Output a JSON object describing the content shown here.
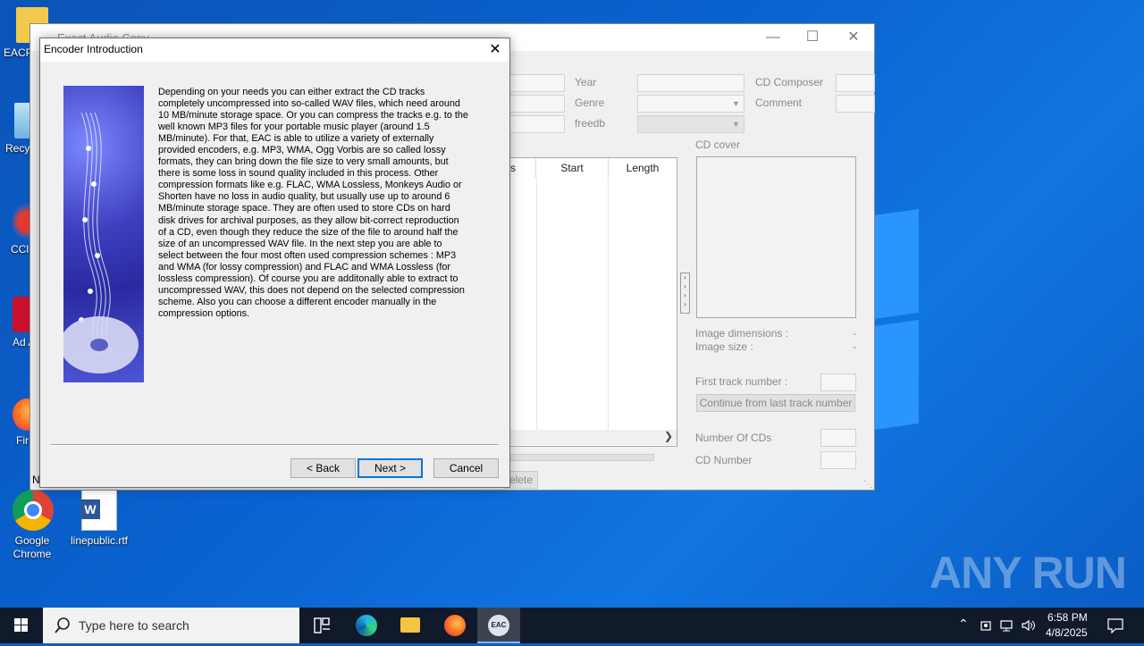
{
  "desktop": {
    "icons": [
      {
        "label": "EACP",
        "name": "desktop-icon-eac-folder"
      },
      {
        "label": "Recyc",
        "name": "desktop-icon-recycle-bin"
      },
      {
        "label": "CCl",
        "name": "desktop-icon-ccleaner"
      },
      {
        "label": "Ad Acr",
        "name": "desktop-icon-acrobat"
      },
      {
        "label": "Fir",
        "name": "desktop-icon-firefox"
      },
      {
        "label": "Google Chrome",
        "name": "desktop-icon-chrome"
      },
      {
        "label": "linepublic.rtf",
        "name": "desktop-icon-rtf-file"
      }
    ],
    "watermark": "ANY RUN"
  },
  "eac_window": {
    "title": "Exact Audio Copy",
    "labels": {
      "year": "Year",
      "genre": "Genre",
      "freedb": "freedb",
      "cd_composer": "CD Composer",
      "comment": "Comment",
      "cd_cover": "CD cover",
      "image_dimensions": "Image dimensions :",
      "image_dimensions_value": "-",
      "image_size": "Image size :",
      "image_size_value": "-",
      "first_track_number": "First track number :",
      "continue_button": "Continue from last track number",
      "number_of_cds": "Number Of CDs",
      "cd_number": "CD Number",
      "delete_button": "elete",
      "status_letter": "N"
    },
    "columns": [
      "s",
      "Start",
      "Length"
    ]
  },
  "dialog": {
    "title": "Encoder Introduction",
    "text": "Depending on your needs you can either extract the CD tracks completely uncompressed into so-called WAV files, which need around 10 MB/minute storage space. Or you can compress the tracks e.g. to the well known MP3 files for your portable music player (around 1.5 MB/minute). For that, EAC is able to utilize a variety of externally provided encoders, e.g. MP3, WMA, Ogg Vorbis are so called lossy formats, they can bring down the file size to very small amounts, but there is some loss in sound quality included in this process. Other compression formats like e.g. FLAC, WMA Lossless, Monkeys Audio or Shorten have no loss in audio quality, but usually use up to around 6 MB/minute storage space. They are often used to store CDs on hard disk drives for archival purposes, as they allow bit-correct reproduction of a CD, even though they reduce the size of the file to around half the size of an uncompressed WAV file. In the next step you are able to select between the four most often used compression schemes : MP3 and WMA (for lossy compression) and FLAC and WMA Lossless (for lossless compression). Of course you are additonally able to extract to uncompressed WAV, this does not depend on the selected compression scheme. Also you can choose a different encoder manually in the compression options.",
    "back_label": "< Back",
    "next_label": "Next >",
    "cancel_label": "Cancel"
  },
  "taskbar": {
    "search_placeholder": "Type here to search",
    "active_app": "EAC",
    "time": "6:58 PM",
    "date": "4/8/2025"
  }
}
